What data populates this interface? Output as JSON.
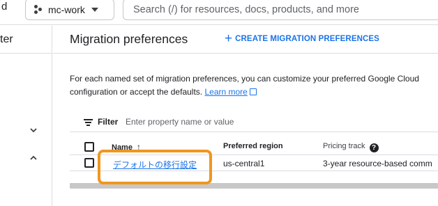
{
  "topbar": {
    "left_fragment": "d",
    "project": "mc-work",
    "search_placeholder": "Search (/) for resources, docs, products, and more"
  },
  "leftnav": {
    "title": "ter",
    "chevrons": [
      "chevron-down-icon",
      "chevron-up-icon"
    ]
  },
  "header": {
    "title": "Migration preferences",
    "create_label": "CREATE MIGRATION PREFERENCES",
    "create_icon": "+"
  },
  "description": {
    "text": "For each named set of migration preferences, you can customize your preferred Google Cloud configuration or accept the defaults.",
    "link": "Learn more"
  },
  "filter": {
    "label": "Filter",
    "placeholder": "Enter property name or value"
  },
  "table": {
    "columns": [
      "Name",
      "Preferred region",
      "Pricing track"
    ],
    "sort_indicator": "↑",
    "rows": [
      {
        "name": "デフォルトの移行設定",
        "region": "us-central1",
        "pricing": "3-year resource-based comm"
      }
    ]
  },
  "colors": {
    "accent": "#1a73e8",
    "highlight": "#f0961e",
    "border": "#dadce0"
  }
}
